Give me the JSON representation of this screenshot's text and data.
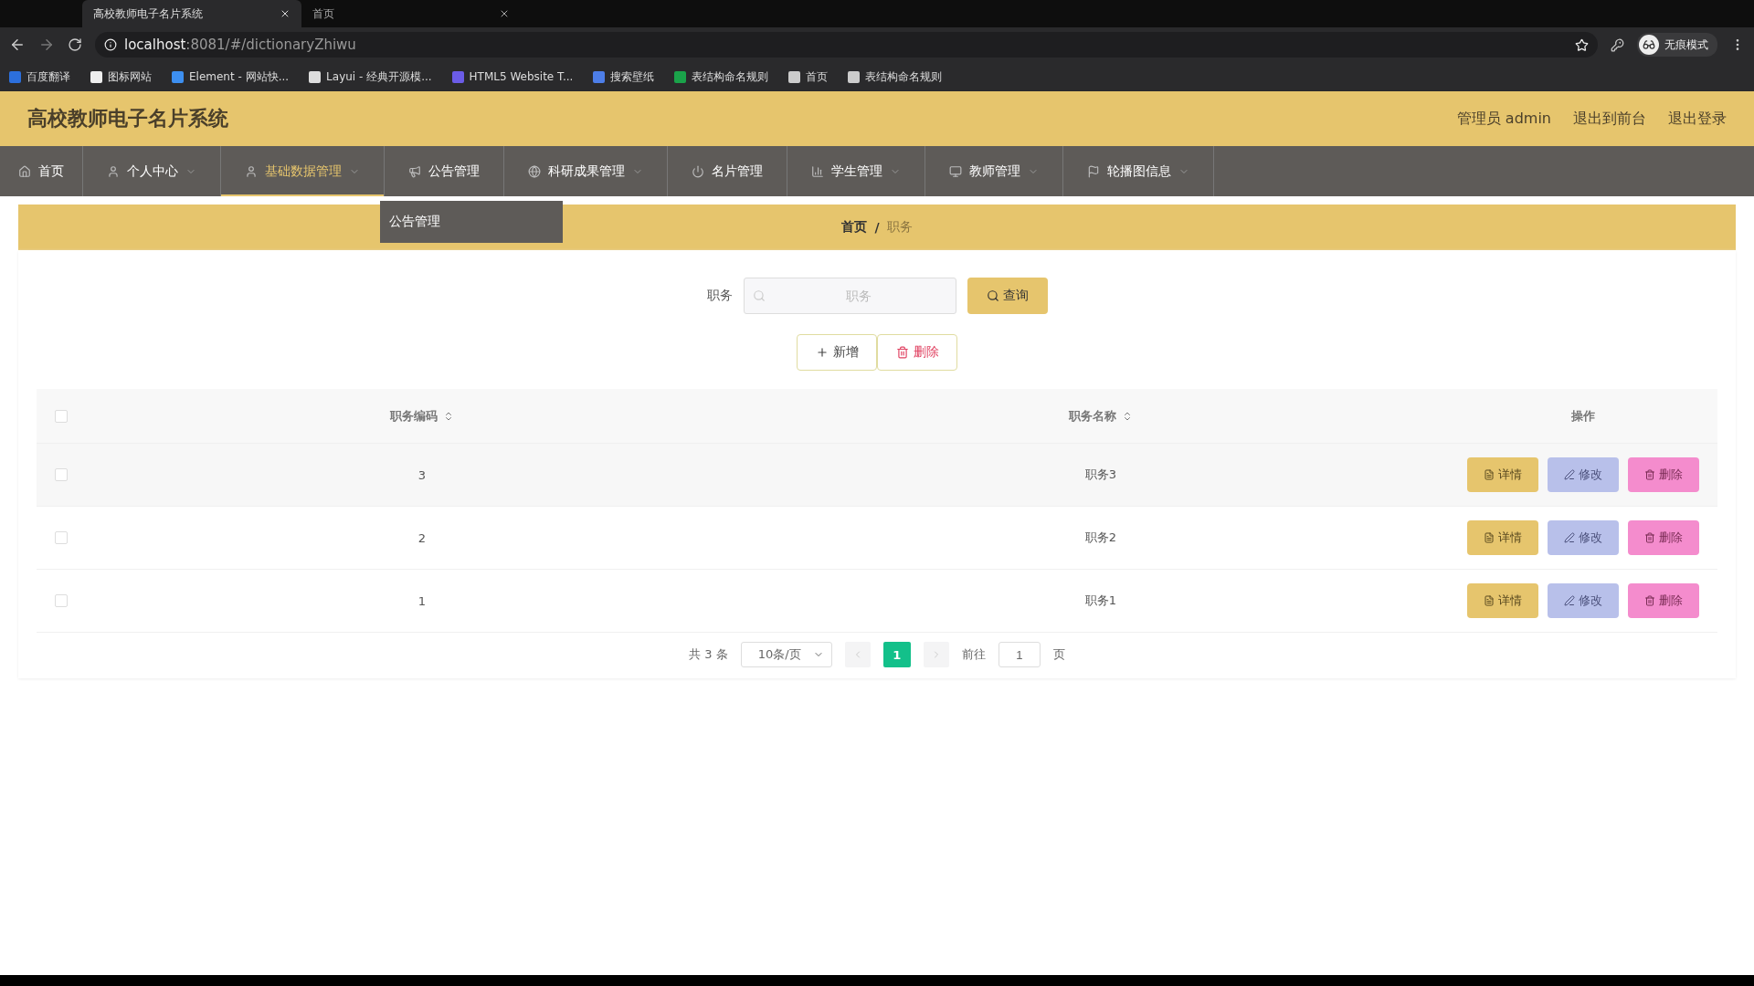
{
  "browser": {
    "tabs": [
      {
        "title": "高校教师电子名片系统",
        "selected": true
      },
      {
        "title": "首页",
        "selected": false
      }
    ],
    "url_host": "localhost",
    "url_rest": ":8081/#/dictionaryZhiwu",
    "bookmarks": [
      "百度翻译",
      "图标网站",
      "Element - 网站快...",
      "Layui - 经典开源模...",
      "HTML5 Website T...",
      "搜索壁纸",
      "表结构命名规则",
      "首页",
      "表结构命名规则"
    ],
    "profile": "无痕模式"
  },
  "header": {
    "title": "高校教师电子名片系统",
    "links": [
      "管理员 admin",
      "退出到前台",
      "退出登录"
    ]
  },
  "nav": [
    {
      "label": "首页",
      "dropdown": false,
      "selected": false
    },
    {
      "label": "个人中心",
      "dropdown": true,
      "selected": false
    },
    {
      "label": "基础数据管理",
      "dropdown": true,
      "selected": true
    },
    {
      "label": "公告管理",
      "dropdown": false,
      "selected": false
    },
    {
      "label": "科研成果管理",
      "dropdown": true,
      "selected": false
    },
    {
      "label": "名片管理",
      "dropdown": false,
      "selected": false
    },
    {
      "label": "学生管理",
      "dropdown": true,
      "selected": false
    },
    {
      "label": "教师管理",
      "dropdown": true,
      "selected": false
    },
    {
      "label": "轮播图信息",
      "dropdown": true,
      "selected": false
    }
  ],
  "dropdown_menu": {
    "items": [
      "公告管理"
    ]
  },
  "breadcrumb": [
    "首页",
    "/",
    "职务"
  ],
  "search": {
    "label": "职务",
    "placeholder": "职务",
    "button": "查询"
  },
  "actions": {
    "add": "新增",
    "delete": "删除"
  },
  "table": {
    "columns": [
      "职务编码",
      "职务名称",
      "操作"
    ],
    "rows": [
      {
        "code": "3",
        "name": "职务3",
        "checked": false,
        "buttons": [
          "详情",
          "修改",
          "删除"
        ]
      },
      {
        "code": "2",
        "name": "职务2",
        "checked": false,
        "buttons": [
          "详情",
          "修改",
          "删除"
        ]
      },
      {
        "code": "1",
        "name": "职务1",
        "checked": false,
        "buttons": [
          "详情",
          "修改",
          "删除"
        ]
      }
    ],
    "header_checked": false
  },
  "pagination": {
    "total": "共 3 条",
    "page_size": "10条/页",
    "pages": [
      {
        "label": "1",
        "selected": true
      }
    ],
    "goto_label": "前往",
    "goto_value": "1",
    "page_suffix": "页"
  }
}
